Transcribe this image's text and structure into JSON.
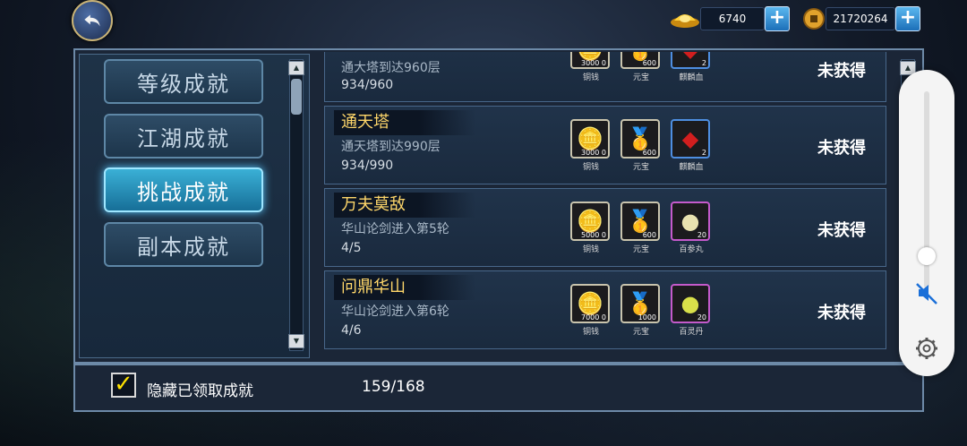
{
  "currency": {
    "gold_ingot": "6740",
    "coins": "21720264"
  },
  "categories": [
    {
      "label": "等级成就"
    },
    {
      "label": "江湖成就"
    },
    {
      "label": "挑战成就"
    },
    {
      "label": "副本成就"
    }
  ],
  "active_category": "挑战成就",
  "achievements": [
    {
      "title": "",
      "desc": "通大塔到达960层",
      "progress": "934/960",
      "rewards": [
        {
          "name": "铜钱",
          "count": "3000 0"
        },
        {
          "name": "元宝",
          "count": "600"
        },
        {
          "name": "麒麟血",
          "count": "2"
        }
      ],
      "status": "未获得"
    },
    {
      "title": "通天塔",
      "desc": "通天塔到达990层",
      "progress": "934/990",
      "rewards": [
        {
          "name": "铜钱",
          "count": "3000 0"
        },
        {
          "name": "元宝",
          "count": "600"
        },
        {
          "name": "麒麟血",
          "count": "2"
        }
      ],
      "status": "未获得"
    },
    {
      "title": "万夫莫敌",
      "desc": "华山论剑进入第5轮",
      "progress": "4/5",
      "rewards": [
        {
          "name": "铜钱",
          "count": "5000 0"
        },
        {
          "name": "元宝",
          "count": "600"
        },
        {
          "name": "百参丸",
          "count": "20"
        }
      ],
      "status": "未获得"
    },
    {
      "title": "问鼎华山",
      "desc": "华山论剑进入第6轮",
      "progress": "4/6",
      "rewards": [
        {
          "name": "铜钱",
          "count": "7000 0"
        },
        {
          "name": "元宝",
          "count": "1000"
        },
        {
          "name": "百灵丹",
          "count": "20"
        }
      ],
      "status": "未获得"
    }
  ],
  "footer": {
    "hide_claimed_label": "隐藏已领取成就",
    "count": "159/168"
  },
  "icons": {
    "back": "back-arrow-icon",
    "gold_ingot": "gold-ingot-icon",
    "coin": "copper-coin-icon",
    "mute": "volume-mute-icon",
    "settings": "gear-icon"
  },
  "colors": {
    "title": "#ffd76a",
    "active_tab": "#3ab0d6",
    "panel_border": "#6d8aa8"
  }
}
